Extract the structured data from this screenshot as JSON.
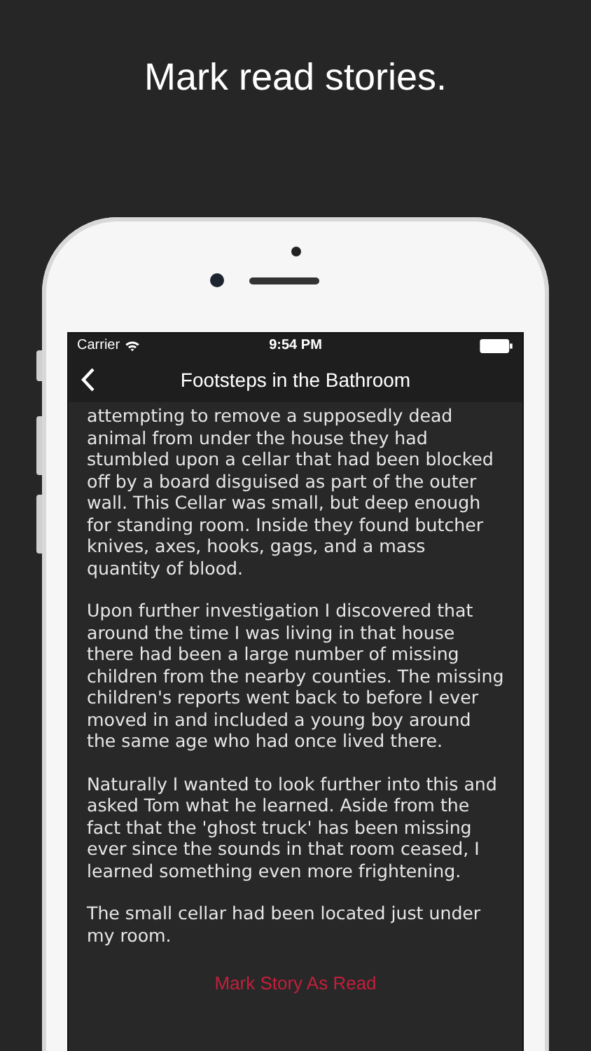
{
  "headline": "Mark read stories.",
  "status_bar": {
    "carrier": "Carrier",
    "time": "9:54 PM"
  },
  "nav_bar": {
    "title": "Footsteps in the Bathroom"
  },
  "story": {
    "paragraphs": [
      "attempting to remove a supposedly dead animal from under the house they had stumbled upon a cellar that had been blocked off by a board disguised as part of the outer wall. This Cellar was small, but deep enough for standing room. Inside they found butcher knives, axes, hooks, gags, and a mass quantity of blood.",
      "Upon further investigation I discovered that around the time I was living in that house there had been a large number of missing children from the nearby counties. The missing children's reports went back to before I ever moved in and included a young boy around the same age who had once lived there.",
      "Naturally I wanted to look further into this and asked Tom what he learned. Aside from the fact that the 'ghost truck' has been missing ever since the sounds in that room ceased, I learned something even more frightening.",
      "The small cellar had been located just under my room."
    ]
  },
  "action_button": {
    "label": "Mark Story As Read"
  }
}
